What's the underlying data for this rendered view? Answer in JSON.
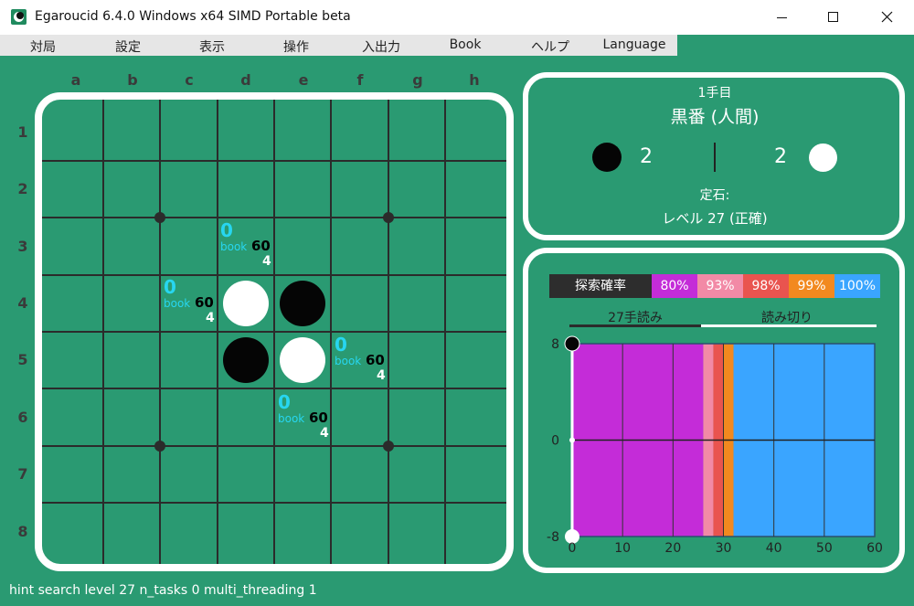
{
  "window": {
    "title": "Egaroucid 6.4.0 Windows x64 SIMD Portable beta"
  },
  "menu": [
    "対局",
    "設定",
    "表示",
    "操作",
    "入出力",
    "Book",
    "ヘルプ",
    "Language"
  ],
  "board": {
    "columns": [
      "a",
      "b",
      "c",
      "d",
      "e",
      "f",
      "g",
      "h"
    ],
    "rows": [
      "1",
      "2",
      "3",
      "4",
      "5",
      "6",
      "7",
      "8"
    ],
    "stones": [
      {
        "cell": "d4",
        "color": "white"
      },
      {
        "cell": "e4",
        "color": "black"
      },
      {
        "cell": "d5",
        "color": "black"
      },
      {
        "cell": "e5",
        "color": "white"
      }
    ],
    "hints": [
      {
        "cell": "d3",
        "value": "0",
        "book": "book",
        "level": "60",
        "depth": "4"
      },
      {
        "cell": "c4",
        "value": "0",
        "book": "book",
        "level": "60",
        "depth": "4"
      },
      {
        "cell": "f5",
        "value": "0",
        "book": "book",
        "level": "60",
        "depth": "4"
      },
      {
        "cell": "e6",
        "value": "0",
        "book": "book",
        "level": "60",
        "depth": "4"
      }
    ]
  },
  "info": {
    "move": "1手目",
    "turn": "黒番 (人間)",
    "black_count": "2",
    "white_count": "2",
    "opening_label": "定石:",
    "level": "レベル 27 (正確)"
  },
  "graph": {
    "legend_label": "探索確率",
    "legend": [
      {
        "label": "80%",
        "color": "#c42cd8"
      },
      {
        "label": "93%",
        "color": "#f28aa6"
      },
      {
        "label": "98%",
        "color": "#e9544f"
      },
      {
        "label": "99%",
        "color": "#f2891f"
      },
      {
        "label": "100%",
        "color": "#3aa5ff"
      }
    ],
    "tab_left": "27手読み",
    "tab_right": "読み切り"
  },
  "chart_data": {
    "type": "line",
    "x": [
      0
    ],
    "series": [
      {
        "values": [
          0
        ]
      }
    ],
    "xlim": [
      0,
      60
    ],
    "ylim": [
      -8,
      8
    ],
    "xticks": [
      "0",
      "10",
      "20",
      "30",
      "40",
      "50",
      "60"
    ],
    "yticks": [
      "8",
      "0",
      "-8"
    ],
    "background_bands": [
      {
        "from": 0,
        "to": 26,
        "color": "#c42cd8"
      },
      {
        "from": 26,
        "to": 28,
        "color": "#f28aa6"
      },
      {
        "from": 28,
        "to": 30,
        "color": "#e9544f"
      },
      {
        "from": 30,
        "to": 32,
        "color": "#f2891f"
      },
      {
        "from": 32,
        "to": 60,
        "color": "#3aa5ff"
      }
    ]
  },
  "status": "hint search level 27 n_tasks 0 multi_threading 1"
}
